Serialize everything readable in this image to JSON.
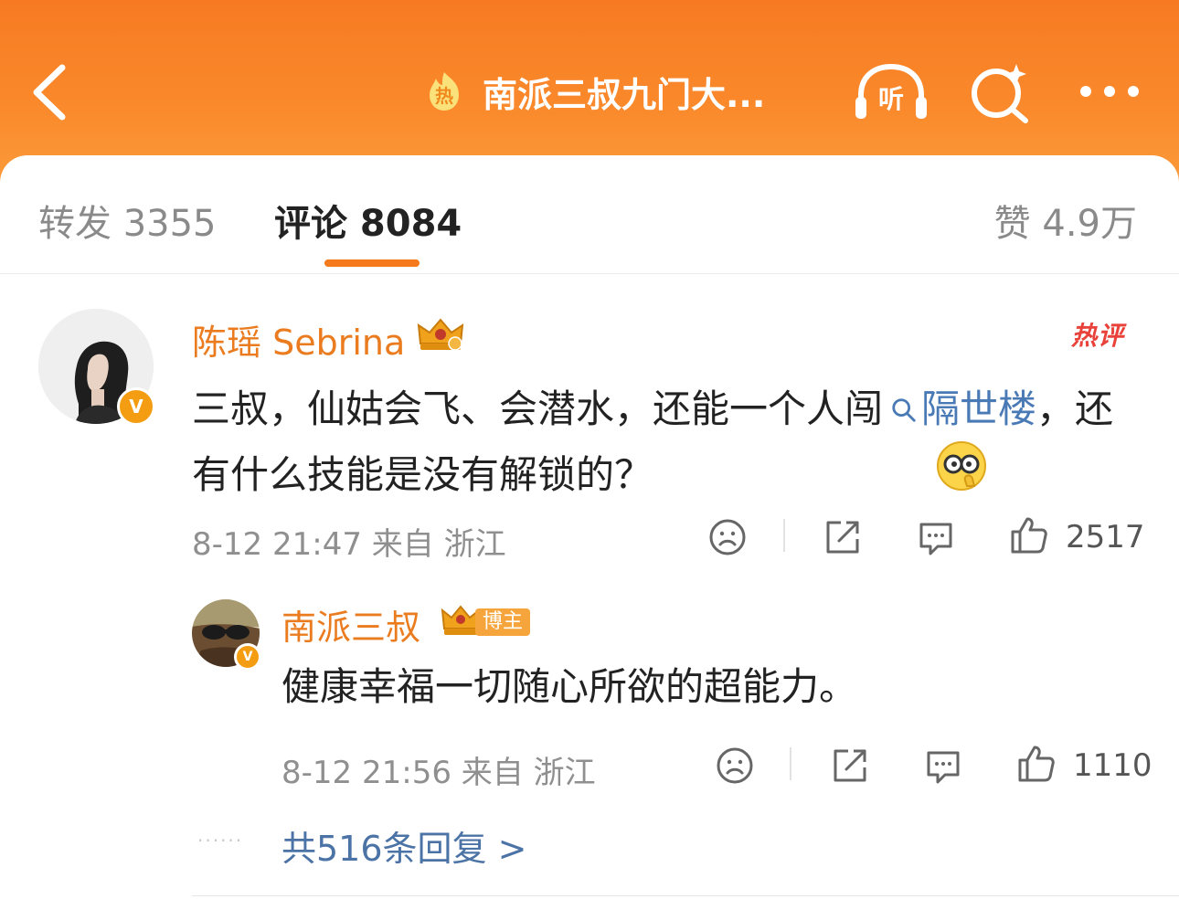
{
  "header": {
    "title": "南派三叔九门大...",
    "hot_icon_text": "热",
    "listen_label": "听"
  },
  "tabs": {
    "repost": "转发 3355",
    "comment": "评论 8084",
    "like": "赞 4.9万"
  },
  "comments": [
    {
      "username": "陈瑶 Sebrina",
      "badge": "热评",
      "text_before_link": "三叔，仙姑会飞、会潜水，还能一个人闯",
      "link_text": "隔世楼",
      "text_after_link": "，还有什么技能是没有解锁的？",
      "time_location": "8-12 21:47  来自 浙江",
      "likes": "2517"
    },
    {
      "username": "南派三叔",
      "tag": "博主",
      "text": "健康幸福一切随心所欲的超能力。",
      "time_location": "8-12 21:56  来自 浙江",
      "likes": "1110"
    }
  ],
  "replies_link": "共516条回复 >",
  "colors": {
    "header_orange": "#f77a22",
    "accent": "#f57a1c",
    "username": "#ea7c1f",
    "link": "#4a7ab5",
    "hot_badge": "#e8423a"
  },
  "icons": [
    "back-icon",
    "hot-icon",
    "headphones-icon",
    "search-icon",
    "more-icon",
    "crown-icon",
    "sad-face-icon",
    "share-icon",
    "comment-icon",
    "thumbs-up-icon",
    "nerd-emoji"
  ]
}
